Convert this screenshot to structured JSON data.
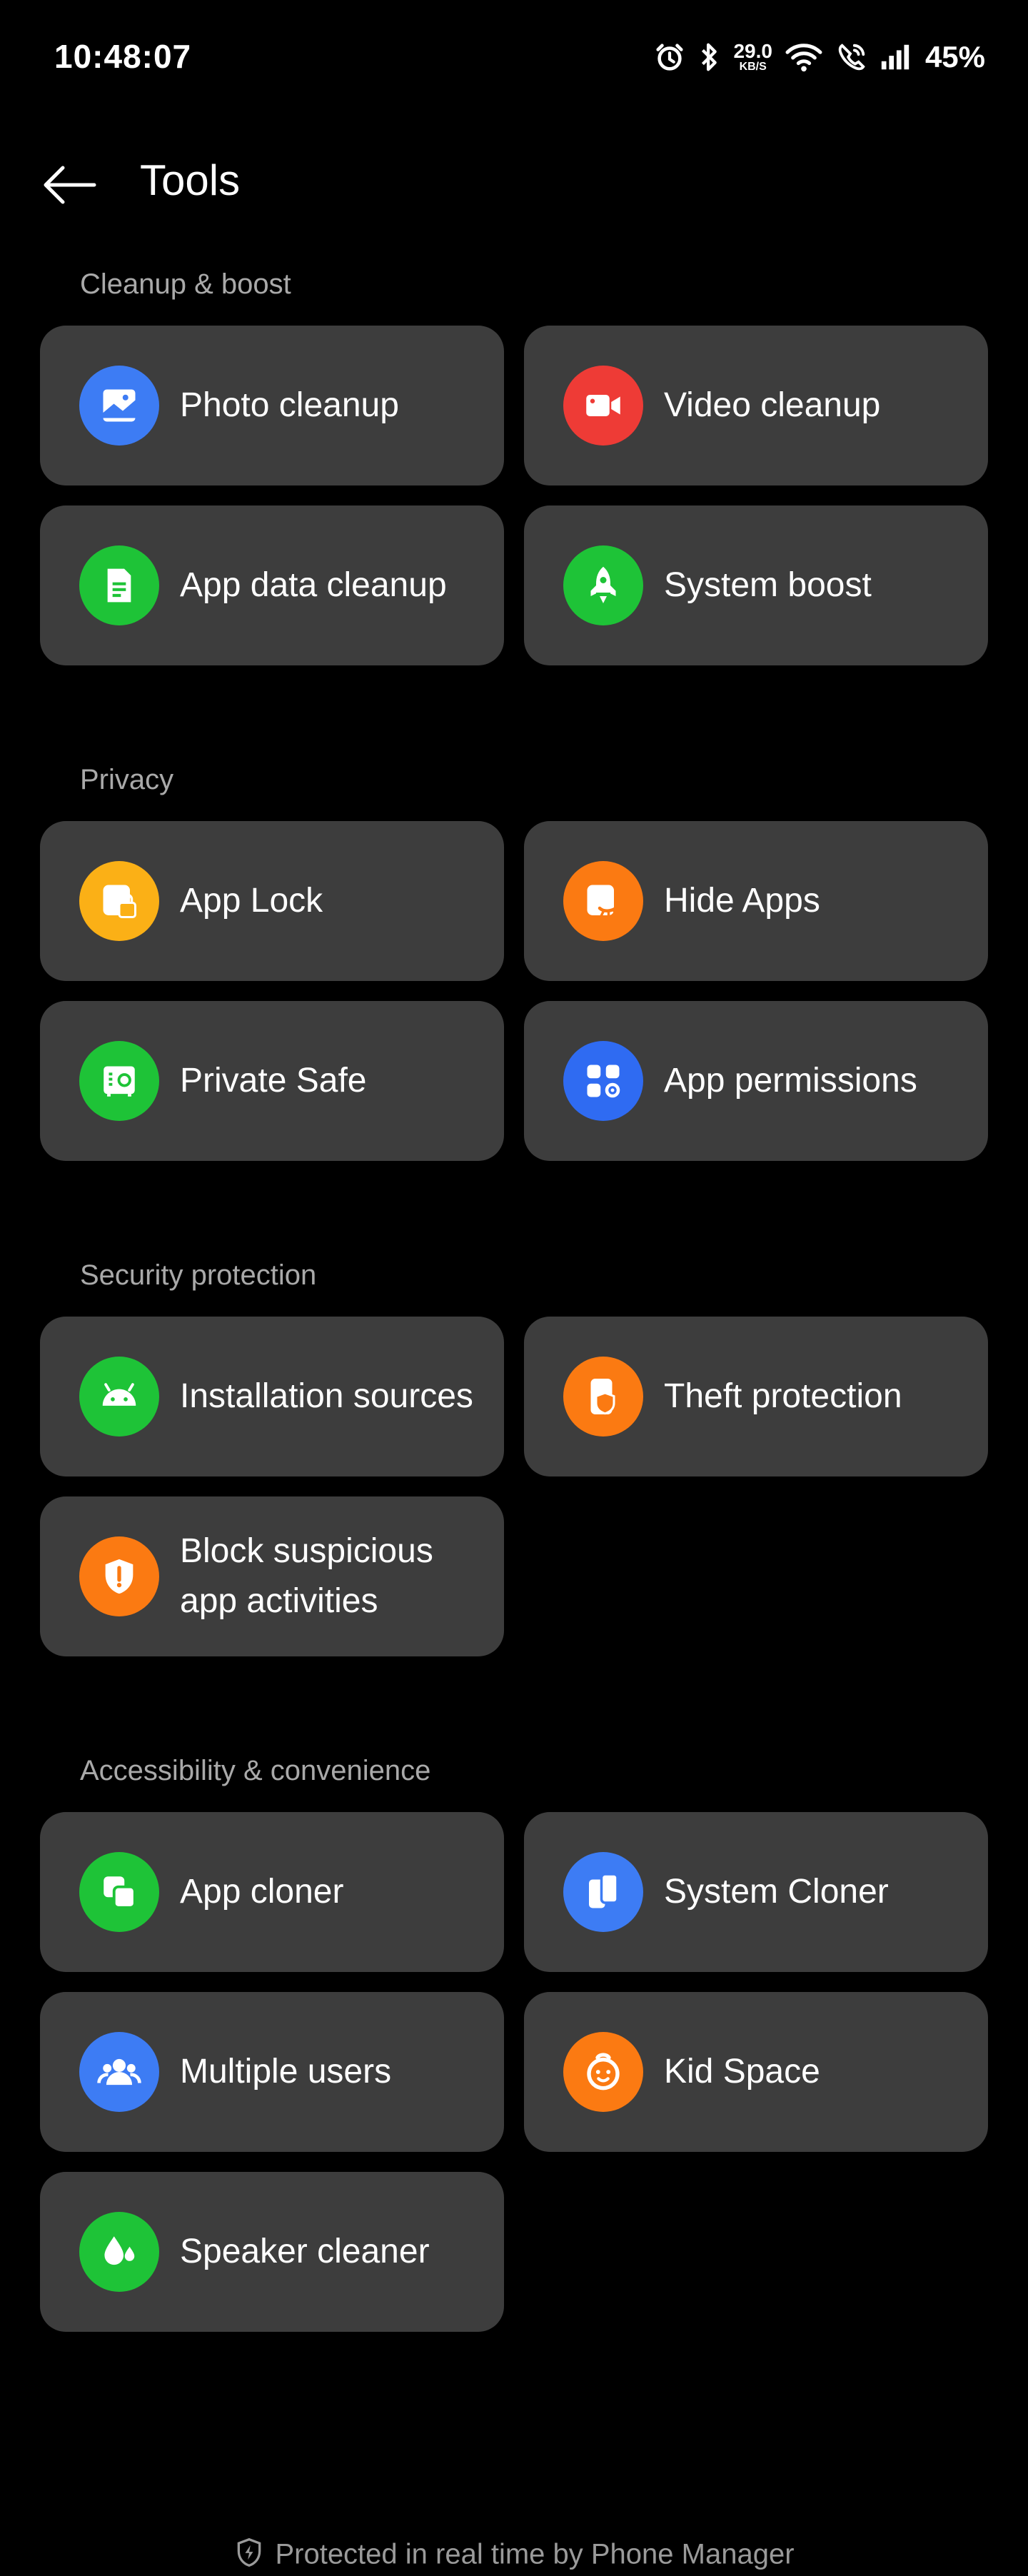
{
  "status_bar": {
    "time": "10:48:07",
    "net_speed_value": "29.0",
    "net_speed_unit": "KB/S",
    "battery": "45%"
  },
  "header": {
    "title": "Tools"
  },
  "sections": {
    "cleanup": {
      "title": "Cleanup & boost",
      "items": {
        "photo": "Photo cleanup",
        "video": "Video cleanup",
        "appdata": "App data cleanup",
        "boost": "System boost"
      }
    },
    "privacy": {
      "title": "Privacy",
      "items": {
        "applock": "App Lock",
        "hideapps": "Hide Apps",
        "safe": "Private Safe",
        "permissions": "App permissions"
      }
    },
    "security": {
      "title": "Security protection",
      "items": {
        "install": "Installation sources",
        "theft": "Theft protection",
        "block": "Block suspicious app activities"
      }
    },
    "accessibility": {
      "title": "Accessibility & convenience",
      "items": {
        "appcloner": "App cloner",
        "syscloner": "System Cloner",
        "users": "Multiple users",
        "kid": "Kid Space",
        "speaker": "Speaker cleaner"
      }
    }
  },
  "footer": {
    "text": "Protected in real time by Phone Manager"
  },
  "colors": {
    "background": "#000000",
    "card": "#3d3d3d",
    "blue": "#3d7cf4",
    "red": "#ee3b36",
    "green": "#1ec337",
    "yellow": "#fbb016",
    "orange": "#fb7a12"
  }
}
